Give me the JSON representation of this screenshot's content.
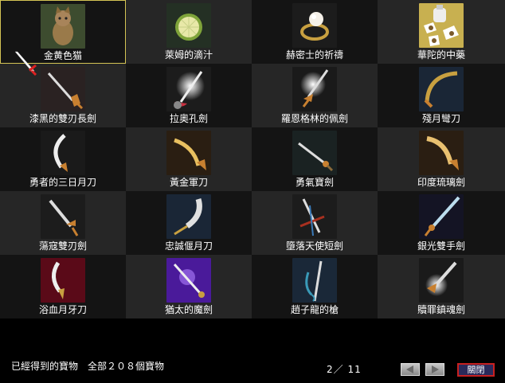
{
  "items": [
    {
      "label": "金黄色猫",
      "icon": "golden-cat-icon"
    },
    {
      "label": "萊姆的滴汁",
      "icon": "lime-juice-icon"
    },
    {
      "label": "赫密士的祈禱",
      "icon": "hermes-ring-icon"
    },
    {
      "label": "華陀的中藥",
      "icon": "herbal-medicine-icon"
    },
    {
      "label": "漆黑的雙刃長劍",
      "icon": "black-longsword-icon"
    },
    {
      "label": "拉奧孔劍",
      "icon": "laocoon-sword-icon"
    },
    {
      "label": "羅恩格林的佩劍",
      "icon": "lohengrin-sword-icon"
    },
    {
      "label": "殘月彎刀",
      "icon": "crescent-scimitar-icon"
    },
    {
      "label": "勇者的三日月刀",
      "icon": "crescent-blade-icon"
    },
    {
      "label": "黃金軍刀",
      "icon": "golden-saber-icon"
    },
    {
      "label": "勇氣寶劍",
      "icon": "courage-sword-icon"
    },
    {
      "label": "印度琉璃劍",
      "icon": "indian-glass-sword-icon"
    },
    {
      "label": "蕩寇雙刃劍",
      "icon": "double-edged-sword-icon"
    },
    {
      "label": "忠誠偃月刀",
      "icon": "guandao-blade-icon"
    },
    {
      "label": "墮落天使短劍",
      "icon": "fallen-angel-dagger-icon"
    },
    {
      "label": "銀光雙手劍",
      "icon": "silver-greatsword-icon"
    },
    {
      "label": "浴血月牙刀",
      "icon": "bloody-crescent-blade-icon"
    },
    {
      "label": "猶太的魔劍",
      "icon": "judas-demon-sword-icon"
    },
    {
      "label": "趙子龍的槍",
      "icon": "zhao-zilong-spear-icon"
    },
    {
      "label": "贖罪鎮魂劍",
      "icon": "atonement-sword-icon"
    }
  ],
  "footer": {
    "status": "已經得到的寶物　全部２０８個寶物",
    "page": "2／ 11",
    "close_label": "關閉"
  },
  "colors": {
    "selection_border": "#d4c455",
    "close_border": "#c82020"
  }
}
